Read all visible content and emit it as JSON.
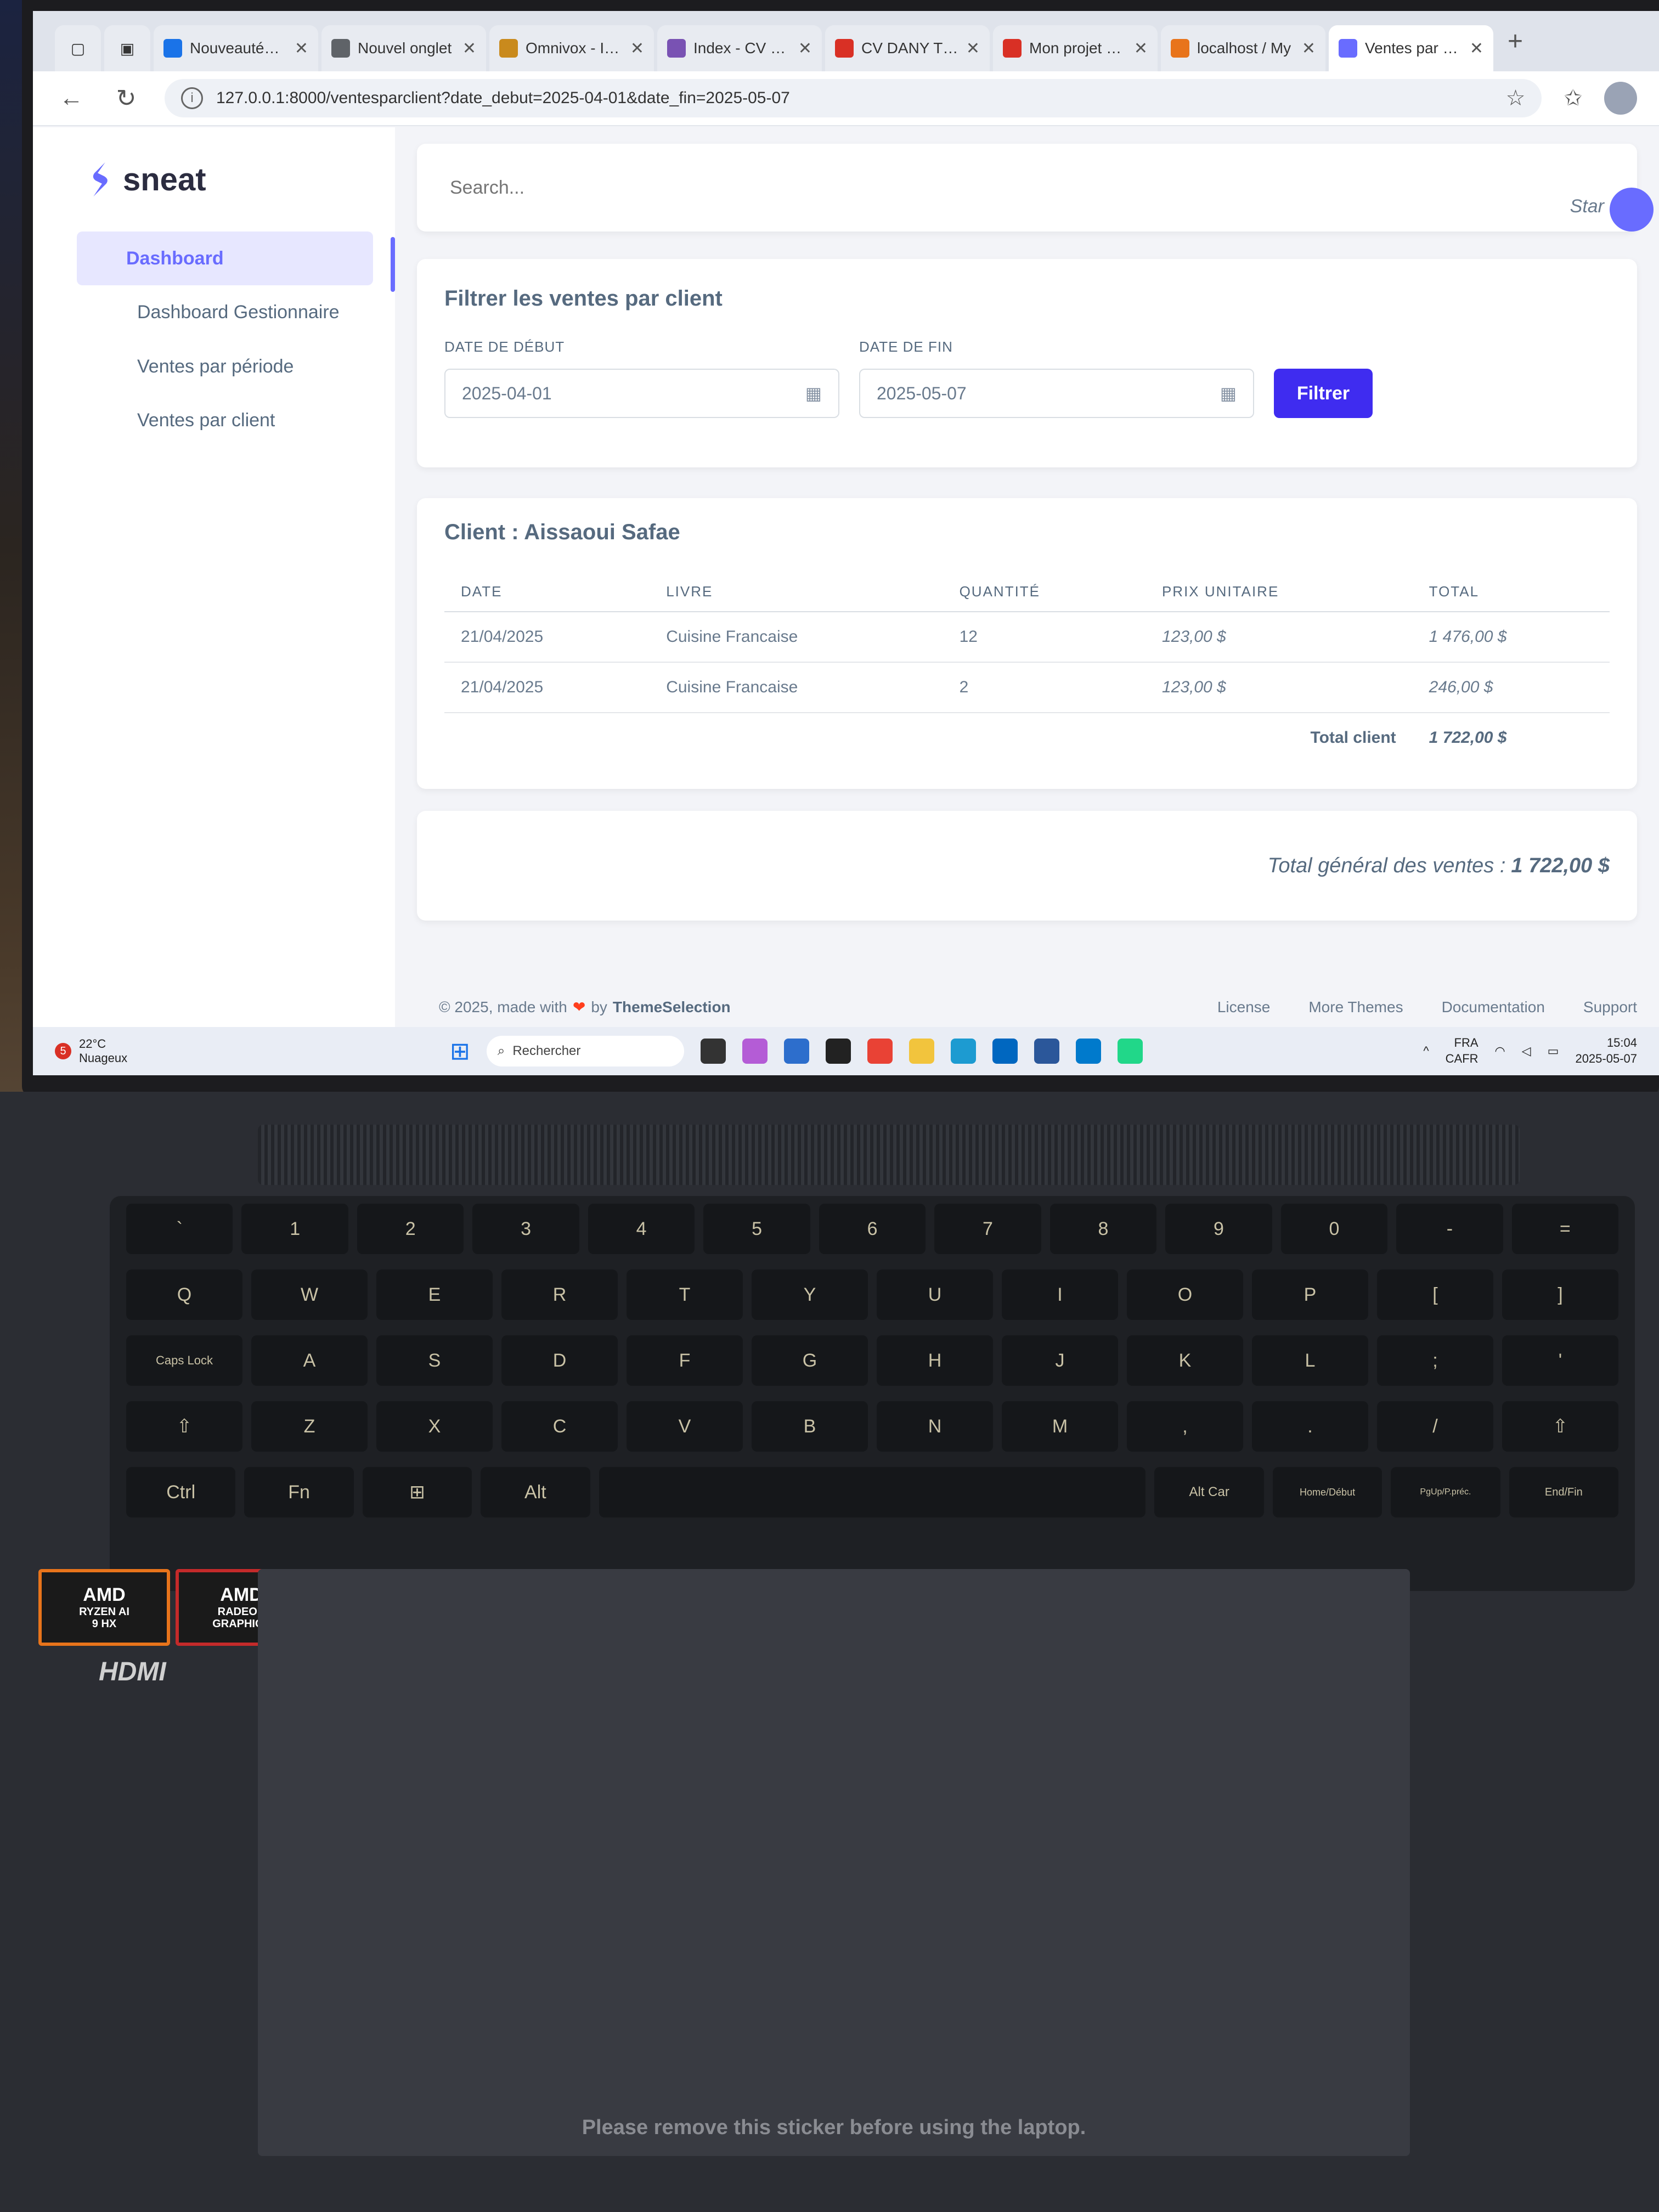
{
  "browser": {
    "tabs": [
      {
        "title": "Nouveautés M",
        "favicon_color": "#1a73e8"
      },
      {
        "title": "Nouvel onglet",
        "favicon_color": "#5f6368"
      },
      {
        "title": "Omnivox - Inst",
        "favicon_color": "#c98a1d"
      },
      {
        "title": "Index - CV et P",
        "favicon_color": "#7952b3"
      },
      {
        "title": "CV DANY TREM",
        "favicon_color": "#d93025"
      },
      {
        "title": "Mon projet sur",
        "favicon_color": "#d93025"
      },
      {
        "title": "localhost / My",
        "favicon_color": "#e8741b"
      },
      {
        "title": "Ventes par clie",
        "favicon_color": "#696cff",
        "active": true
      }
    ],
    "url": "127.0.0.1:8000/ventesparclient?date_debut=2025-04-01&date_fin=2025-05-07"
  },
  "sidebar": {
    "brand": "sneat",
    "items": [
      {
        "label": "Dashboard"
      },
      {
        "label": "Dashboard Gestionnaire"
      },
      {
        "label": "Ventes par période"
      },
      {
        "label": "Ventes par client"
      }
    ]
  },
  "navbar": {
    "search_placeholder": "Search...",
    "star_label": "Star"
  },
  "filter": {
    "title": "Filtrer les ventes par client",
    "start_label": "DATE DE DÉBUT",
    "start_value": "2025-04-01",
    "end_label": "DATE DE FIN",
    "end_value": "2025-05-07",
    "button": "Filtrer"
  },
  "client": {
    "title": "Client : Aissaoui Safae",
    "columns": [
      "DATE",
      "LIVRE",
      "QUANTITÉ",
      "PRIX UNITAIRE",
      "TOTAL"
    ],
    "rows": [
      [
        "21/04/2025",
        "Cuisine Francaise",
        "12",
        "123,00 $",
        "1 476,00 $"
      ],
      [
        "21/04/2025",
        "Cuisine Francaise",
        "2",
        "123,00 $",
        "246,00 $"
      ]
    ],
    "total_label": "Total client",
    "total_value": "1 722,00 $"
  },
  "grand_total": {
    "label": "Total général des ventes :",
    "value": "1 722,00 $"
  },
  "footer": {
    "prefix": "© 2025, made with",
    "by": "by",
    "brand": "ThemeSelection",
    "links": [
      "License",
      "More Themes",
      "Documentation",
      "Support"
    ]
  },
  "taskbar": {
    "weather_badge": "5",
    "temperature": "22°C",
    "condition": "Nuageux",
    "search": "Rechercher",
    "lang_top": "FRA",
    "lang_bottom": "CAFR",
    "time": "15:04",
    "date": "2025-05-07"
  },
  "hardware": {
    "sticker_ryzen_top": "AMD",
    "sticker_ryzen_mid": "RYZEN AI",
    "sticker_ryzen_bottom": "9 HX",
    "sticker_radeon_top": "AMD",
    "sticker_radeon_mid": "RADEON",
    "sticker_radeon_bottom": "GRAPHICS",
    "hdmi": "HDMI",
    "touchpad_notice": "Please remove this sticker before using the laptop.",
    "keys": {
      "row1": [
        "`",
        "1",
        "2",
        "3",
        "4",
        "5",
        "6",
        "7",
        "8",
        "9",
        "0",
        "-",
        "="
      ],
      "row2": [
        "Q",
        "W",
        "E",
        "R",
        "T",
        "Y",
        "U",
        "I",
        "O",
        "P",
        "[",
        "]"
      ],
      "row3": [
        "Caps Lock",
        "A",
        "S",
        "D",
        "F",
        "G",
        "H",
        "J",
        "K",
        "L",
        ";",
        "'"
      ],
      "row4": [
        "⇧",
        "Z",
        "X",
        "C",
        "V",
        "B",
        "N",
        "M",
        ",",
        ".",
        "/",
        "⇧"
      ],
      "row5": [
        "Ctrl",
        "Fn",
        "⊞",
        "Alt",
        "",
        "Alt Car",
        "Home/Début",
        "PgUp/P.préc.",
        "End/Fin"
      ]
    }
  }
}
